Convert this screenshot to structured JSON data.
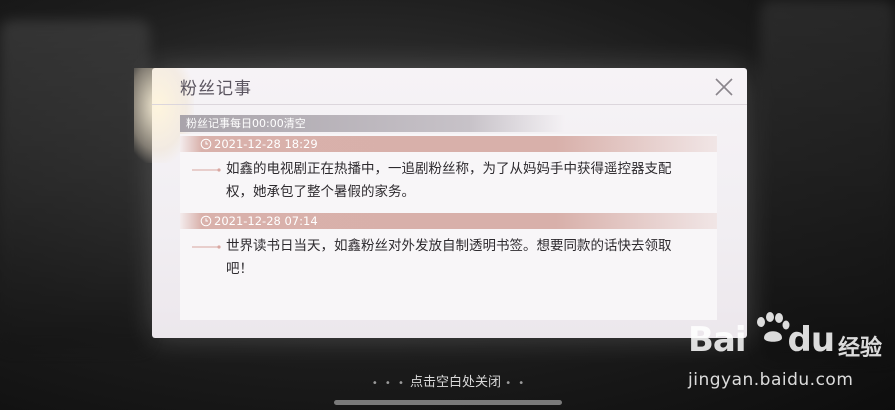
{
  "dialog": {
    "title": "粉丝记事",
    "notice": "粉丝记事每日00:00清空",
    "entries": [
      {
        "timestamp": "2021-12-28 18:29",
        "text": "如鑫的电视剧正在热播中，一追剧粉丝称，为了从妈妈手中获得遥控器支配权，她承包了整个暑假的家务。"
      },
      {
        "timestamp": "2021-12-28 07:14",
        "text": "世界读书日当天，如鑫粉丝对外发放自制透明书签。想要同款的话快去领取吧！"
      }
    ]
  },
  "hint": {
    "dots_left": "• • •",
    "label": "点击空白处关闭",
    "dots_right": "• •"
  },
  "watermark": {
    "logo_text": "Bai",
    "logo_text_tail": "du",
    "brand_cn": "经验",
    "url": "jingyan.baidu.com"
  },
  "icons": {
    "close": "close-icon",
    "clock": "clock-icon",
    "arrow": "arrow-line-icon"
  },
  "colors": {
    "header_rose": "#d8b0aa",
    "notice_gray": "#b3aeb5",
    "text_dark": "#2d2a2e"
  }
}
